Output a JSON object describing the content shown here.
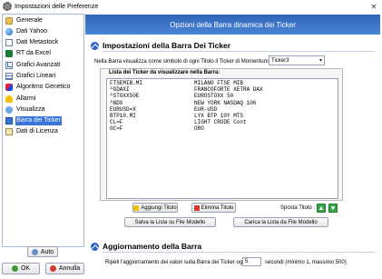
{
  "window": {
    "title": "Impostazioni delle Preferenze"
  },
  "sidebar": {
    "items": [
      {
        "label": "Generale",
        "icon": "folder-icon"
      },
      {
        "label": "Dati Yahoo",
        "icon": "globe-icon"
      },
      {
        "label": "Dati Metastock",
        "icon": "document-icon"
      },
      {
        "label": "RT da Excel",
        "icon": "excel-icon"
      },
      {
        "label": "Grafici Avanzati",
        "icon": "chart-icon"
      },
      {
        "label": "Grafici Lineari",
        "icon": "line-chart-icon"
      },
      {
        "label": "Algoritmo Genetico",
        "icon": "dna-icon"
      },
      {
        "label": "Allarmi",
        "icon": "alarm-icon"
      },
      {
        "label": "Visualizza",
        "icon": "eye-icon"
      },
      {
        "label": "Barra dei Ticker",
        "icon": "ticker-icon",
        "selected": true
      },
      {
        "label": "Dati di Licenza",
        "icon": "license-icon"
      }
    ],
    "auto_label": "Auto"
  },
  "footer": {
    "ok_label": "OK",
    "cancel_label": "Annulla"
  },
  "header": {
    "banner": "Opzioni della Barra dinamica dei Ticker"
  },
  "ticker_settings": {
    "title": "Impostazioni della Barra Dei Ticker",
    "momentum_label": "Nella Barra visualizza come simbolo di ogni Titolo il Ticker di Momentum:",
    "momentum_value": "Ticker3",
    "list_label": "Lista dei Ticker da visualizzare nella Barra:",
    "tickers": [
      {
        "symbol": "FTSEMIB.MI",
        "name": "MILANO FTSE MIB"
      },
      {
        "symbol": "^GDAXI",
        "name": "FRANCOFORTE XETRA DAX"
      },
      {
        "symbol": "^STOXX50E",
        "name": "EUROSTOXX 50"
      },
      {
        "symbol": "^NDX",
        "name": "NEW YORK NASDAQ 100"
      },
      {
        "symbol": "EURUSD=X",
        "name": "EUR-USD"
      },
      {
        "symbol": "BTP10.MI",
        "name": "LYX BTP 10Y MTS"
      },
      {
        "symbol": "CL=F",
        "name": "LIGHT CRUDE Cont"
      },
      {
        "symbol": "GC=F",
        "name": "ORO"
      }
    ],
    "add_label": "Aggiungi Titolo",
    "delete_label": "Elimina Titolo",
    "move_label": "Sposta Titolo :",
    "save_label": "Salva la Lista su File Modello",
    "load_label": "Carica la Lista da File Modello"
  },
  "update": {
    "title": "Aggiornamento della Barra",
    "repeat_label": "Ripeti l'aggiornamento dei valori sulla Barra dei Ticker ogni:",
    "seconds_value": "5",
    "seconds_suffix": "secondi (minimo 1, massimo 500)"
  }
}
